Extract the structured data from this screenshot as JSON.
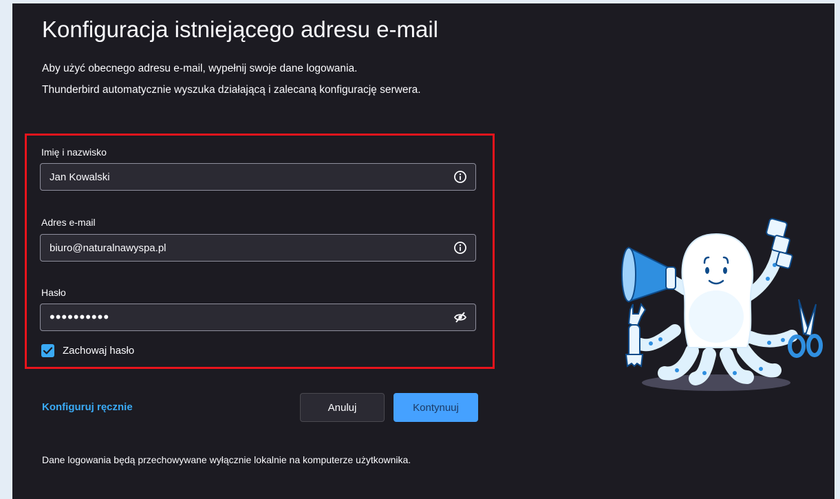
{
  "header": {
    "title": "Konfiguracja istniejącego adresu e-mail",
    "intro_line1": "Aby użyć obecnego adresu e-mail, wypełnij swoje dane logowania.",
    "intro_line2": "Thunderbird automatycznie wyszuka działającą i zalecaną konfigurację serwera."
  },
  "form": {
    "name": {
      "label": "Imię i nazwisko",
      "value": "Jan Kowalski",
      "icon": "info-icon"
    },
    "email": {
      "label": "Adres e-mail",
      "value": "biuro@naturalnawyspa.pl",
      "icon": "info-icon"
    },
    "password": {
      "label": "Hasło",
      "value": "••••••••••",
      "icon": "eye-slash-icon"
    },
    "remember": {
      "label": "Zachowaj hasło",
      "checked": true
    }
  },
  "actions": {
    "manual_config": "Konfiguruj ręcznie",
    "cancel": "Anuluj",
    "continue": "Kontynuuj"
  },
  "footer": {
    "note": "Dane logowania będą przechowywane wyłącznie lokalnie na komputerze użytkownika."
  },
  "colors": {
    "background": "#1c1b22",
    "field_background": "#2b2a33",
    "accent": "#45a1ff",
    "link": "#3aaaf5",
    "highlight_border": "#e8141c"
  }
}
